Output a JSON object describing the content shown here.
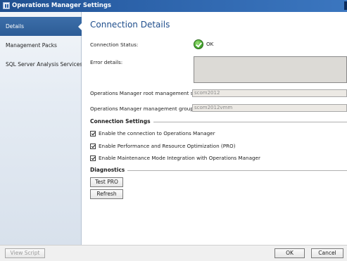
{
  "window": {
    "title": "Operations Manager Settings"
  },
  "sidebar": {
    "items": [
      {
        "label": "Details",
        "selected": true
      },
      {
        "label": "Management Packs",
        "selected": false
      },
      {
        "label": "SQL Server Analysis Services",
        "selected": false
      }
    ]
  },
  "main": {
    "heading": "Connection Details",
    "connection_status_label": "Connection Status:",
    "connection_status_value": "OK",
    "connection_status_icon": "ok-check-icon",
    "error_details_label": "Error details:",
    "error_details_value": "",
    "root_server_label": "Operations Manager root management server:",
    "root_server_value": "scom2012",
    "management_group_label": "Operations Manager management group:",
    "management_group_value": "scom2012vmm",
    "connection_settings_title": "Connection Settings",
    "checkboxes": [
      {
        "label": "Enable the connection to Operations Manager",
        "checked": true
      },
      {
        "label": "Enable Performance and Resource Optimization (PRO)",
        "checked": true
      },
      {
        "label": "Enable Maintenance Mode Integration with Operations Manager",
        "checked": true
      }
    ],
    "diagnostics_title": "Diagnostics",
    "test_pro_label": "Test PRO",
    "refresh_label": "Refresh"
  },
  "footer": {
    "view_script_label": "View Script",
    "ok_label": "OK",
    "cancel_label": "Cancel"
  },
  "colors": {
    "titlebar": "#2b61a8",
    "selected_nav": "#2d5c96",
    "heading": "#1f4e8c",
    "ok_green": "#4caf33"
  }
}
